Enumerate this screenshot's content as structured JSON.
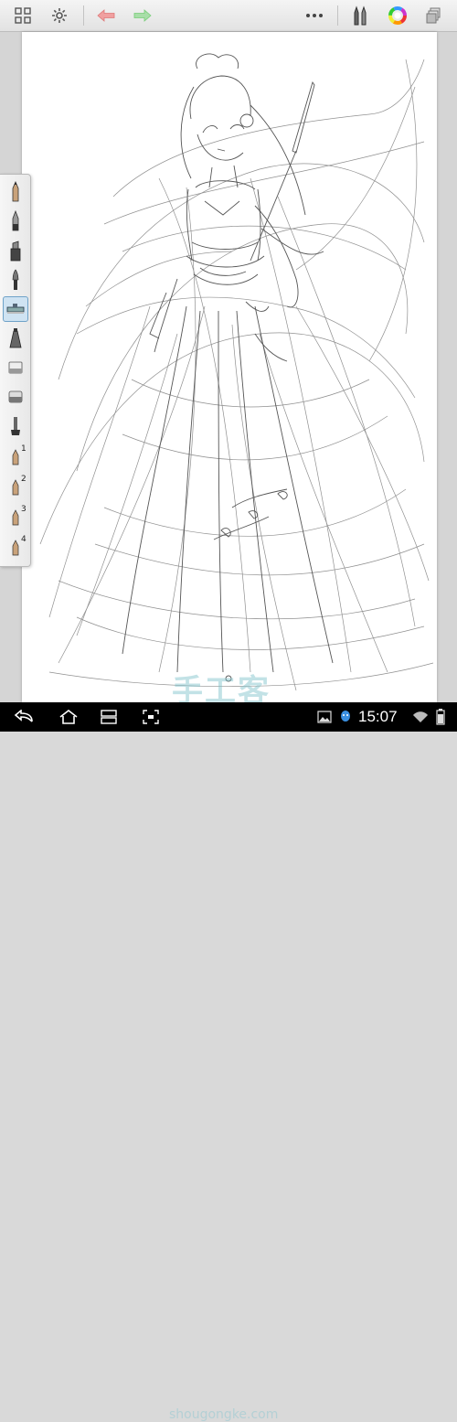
{
  "toolbar": {
    "icons": [
      "grid-icon",
      "gear-icon",
      "undo-icon",
      "redo-icon",
      "more-icon",
      "brushes-icon",
      "color-wheel-icon",
      "layers-icon"
    ],
    "undo_color": "#e88a8a",
    "redo_color": "#8ed58e"
  },
  "palette": {
    "tools": [
      {
        "icon": "pencil-icon"
      },
      {
        "icon": "ballpoint-icon"
      },
      {
        "icon": "marker-icon"
      },
      {
        "icon": "paintbrush-icon"
      },
      {
        "icon": "airbrush-icon",
        "selected": true
      },
      {
        "icon": "smudge-icon"
      },
      {
        "icon": "eraser-icon"
      },
      {
        "icon": "soft-eraser-icon"
      },
      {
        "icon": "fill-icon"
      },
      {
        "icon": "custom-brush-icon",
        "number": "1"
      },
      {
        "icon": "custom-brush-icon",
        "number": "2"
      },
      {
        "icon": "custom-brush-icon",
        "number": "3"
      },
      {
        "icon": "custom-brush-icon",
        "number": "4"
      }
    ]
  },
  "watermark": {
    "chinese": "手工客",
    "url": "shougongke.com"
  },
  "statusbar": {
    "time": "15:07"
  }
}
